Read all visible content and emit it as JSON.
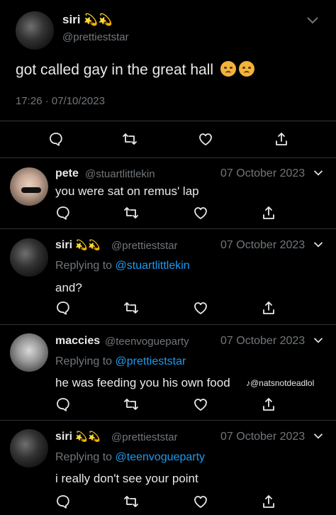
{
  "main_tweet": {
    "name": "siri",
    "emoji": "💫💫",
    "handle": "@prettieststar",
    "text": "got called gay in the great hall",
    "timestamp": "17:26 · 07/10/2023"
  },
  "replies": [
    {
      "name": "pete",
      "handle": "@stuartlittlekin",
      "date": "07 October 2023",
      "replying_prefix": "",
      "replying_to": "",
      "text": "you were sat on remus' lap"
    },
    {
      "name": "siri",
      "emoji": "💫💫",
      "handle": "@prettieststar",
      "date": "07 October 2023",
      "replying_prefix": "Replying to",
      "replying_to": "@stuartlittlekin",
      "text": "and?"
    },
    {
      "name": "maccies",
      "handle": "@teenvogueparty",
      "date": "07 October 2023",
      "replying_prefix": "Replying to",
      "replying_to": "@prettieststar",
      "text": "he was feeding you his own food"
    },
    {
      "name": "siri",
      "emoji": "💫💫",
      "handle": "@prettieststar",
      "date": "07 October 2023",
      "replying_prefix": "Replying to",
      "replying_to": "@teenvogueparty",
      "text": "i really don't see your point"
    }
  ],
  "watermark": "♪@natsnotdeadlol",
  "icons": [
    "reply-icon",
    "retweet-icon",
    "like-icon",
    "share-icon",
    "chevron-down-icon"
  ],
  "colors": {
    "background": "#000000",
    "text": "#e7e9ea",
    "muted": "#71767b",
    "link": "#1d9bf0",
    "divider": "#2f3336"
  }
}
